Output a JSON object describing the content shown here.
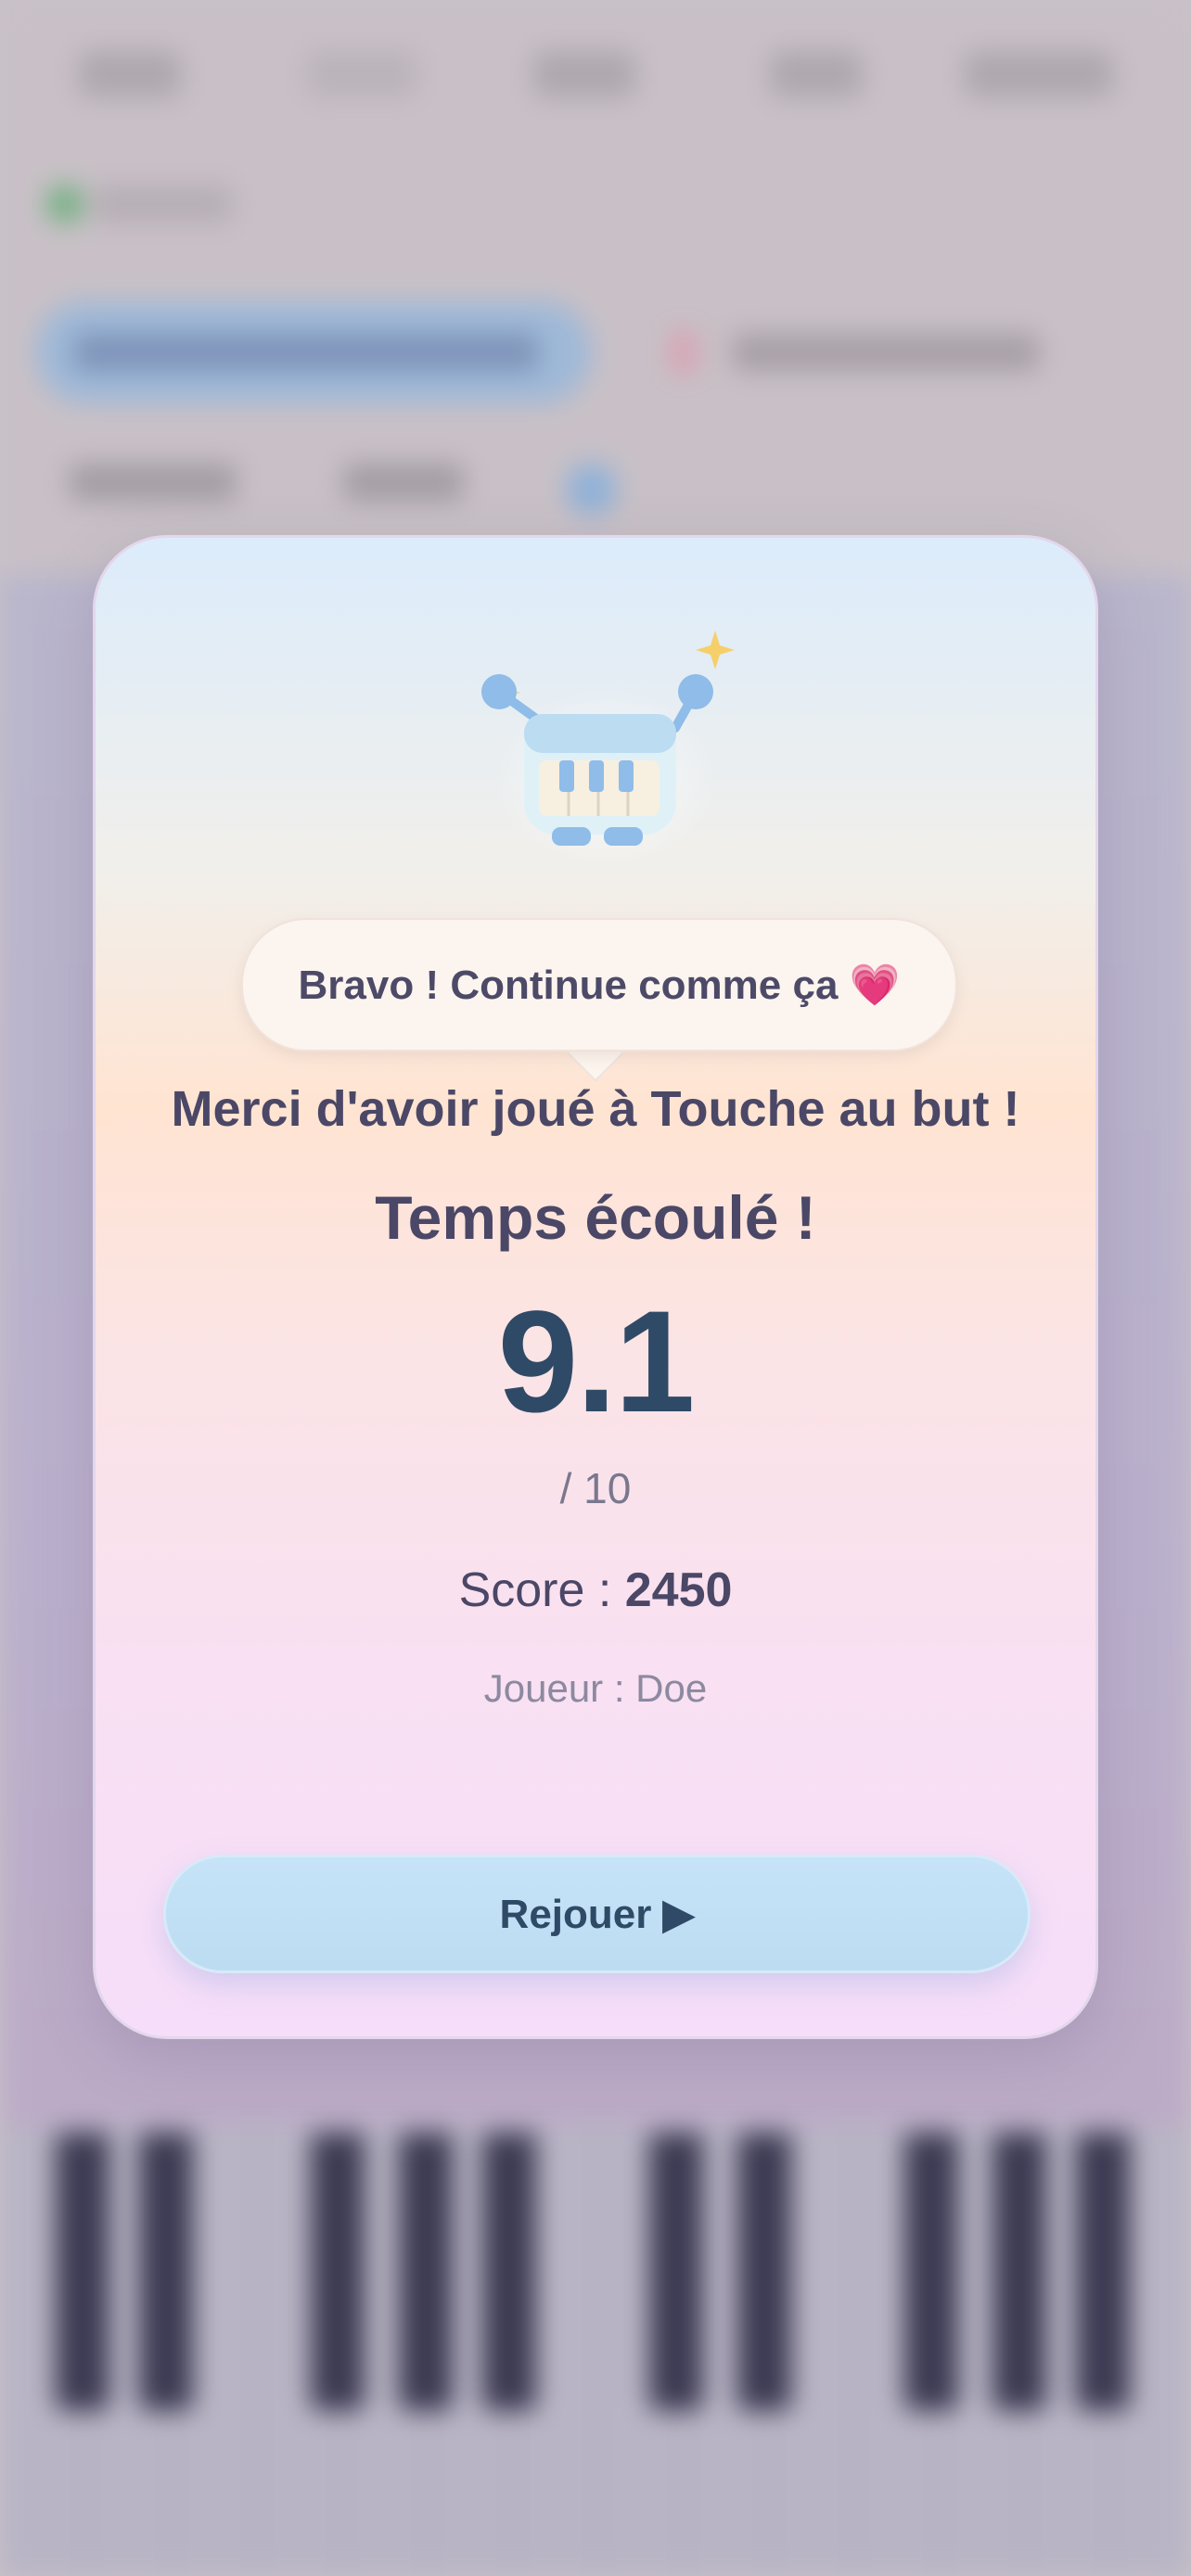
{
  "modal": {
    "bubble_text": "Bravo ! Continue comme ça 💗",
    "thanks_text": "Merci d'avoir joué à Touche au but !",
    "result_title": "Temps écoulé !",
    "rating_value": "9.1",
    "rating_max": "/ 10",
    "score_label": "Score : ",
    "score_value": "2450",
    "player_text": "Joueur : Doe",
    "replay_label": "Rejouer ▶"
  },
  "colors": {
    "accent_text": "#2f4a66",
    "title_text": "#4b4766",
    "button_fill": "#bcdcf2",
    "sparkle": "#f5cf6a"
  },
  "icons": {
    "mascot": "piano-robot-mascot-icon",
    "sparkle": "sparkle-icon",
    "heart": "heart-emoji"
  }
}
